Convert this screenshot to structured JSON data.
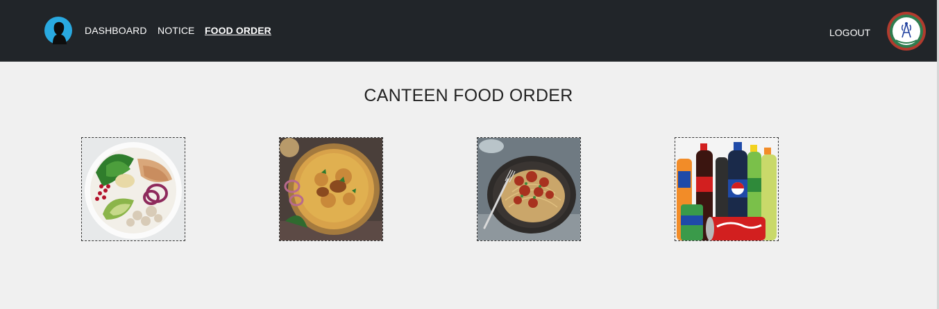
{
  "nav": {
    "links": [
      {
        "label": "DASHBOARD"
      },
      {
        "label": "NOTICE"
      },
      {
        "label": "FOOD ORDER"
      }
    ],
    "logout_label": "LOGOUT"
  },
  "page": {
    "title": "CANTEEN FOOD ORDER"
  },
  "food_items": [
    {
      "image": "salad-bowl"
    },
    {
      "image": "biryani"
    },
    {
      "image": "spaghetti"
    },
    {
      "image": "soft-drinks"
    }
  ],
  "colors": {
    "navbar_bg": "#212529",
    "page_bg": "#f0f0f0",
    "avatar_blue": "#29a9e0",
    "nav_text": "#ffffff"
  }
}
